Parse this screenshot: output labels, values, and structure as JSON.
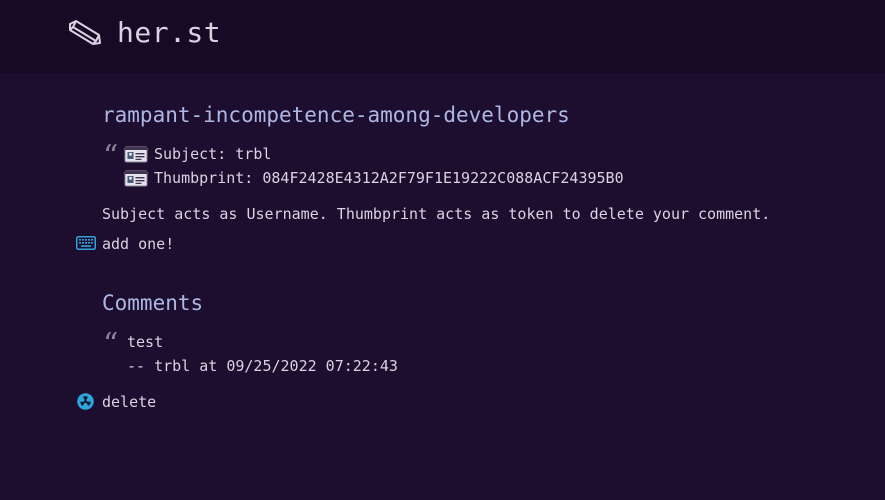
{
  "header": {
    "logo_icon": "pencil-icon",
    "title": "her.st"
  },
  "post": {
    "title": "rampant-incompetence-among-developers",
    "quote_mark": "“",
    "subject": "Subject: trbl",
    "thumbprint": "Thumbprint: 084F2428E4312A2F79F1E19222C088ACF24395B0",
    "cert_icon": "id-card-icon",
    "explanation": "Subject acts as Username. Thumbprint acts as token to delete your comment.",
    "add_icon": "keyboard-icon",
    "add_label": "add one!"
  },
  "comments": {
    "heading": "Comments",
    "items": [
      {
        "quote_mark": "“",
        "text": "test",
        "byline": "-- trbl at 09/25/2022 07:22:43"
      }
    ],
    "delete_icon": "radioactive-icon",
    "delete_label": "delete"
  },
  "colors": {
    "background": "#1d0d2e",
    "header_background": "#170a24",
    "heading": "#aeb7e4",
    "text": "#d9d3e2",
    "icon_accent": "#2fa3dc"
  }
}
